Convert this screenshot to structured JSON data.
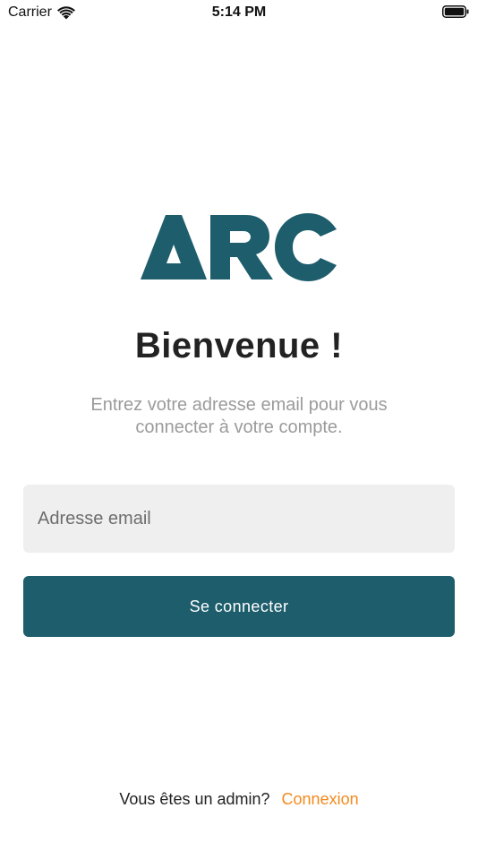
{
  "status_bar": {
    "carrier": "Carrier",
    "time": "5:14 PM",
    "icons": [
      "wifi-icon",
      "battery-icon"
    ]
  },
  "logo": {
    "text": "ARC",
    "color": "#1d5d6c"
  },
  "welcome": {
    "title": "Bienvenue !",
    "subtitle": "Entrez votre adresse email pour vous connecter à votre compte."
  },
  "form": {
    "email_placeholder": "Adresse email",
    "email_value": "",
    "submit_label": "Se connecter"
  },
  "footer": {
    "prompt": "Vous êtes un admin?",
    "link_label": "Connexion"
  },
  "colors": {
    "brand": "#1d5d6c",
    "accent": "#f28a1e",
    "input_bg": "#efefef",
    "subtitle": "#9b9b9b"
  }
}
